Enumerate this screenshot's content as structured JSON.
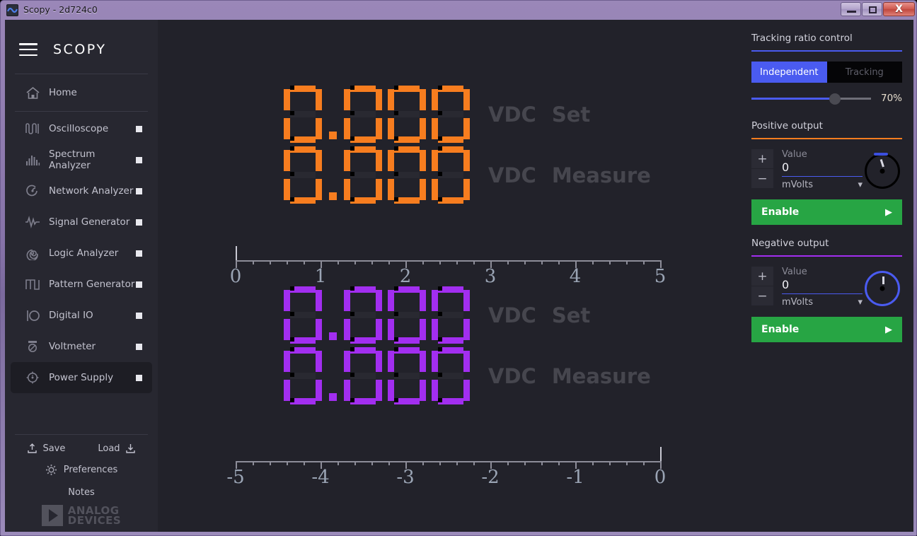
{
  "window": {
    "title": "Scopy - 2d724c0",
    "minimize_label": "Minimize",
    "maximize_label": "Maximize",
    "close_label": "X"
  },
  "sidebar": {
    "logo": "SCOPY",
    "home": {
      "label": "Home",
      "icon": "home-icon"
    },
    "items": [
      {
        "label": "Oscilloscope",
        "icon": "oscilloscope-icon"
      },
      {
        "label": "Spectrum Analyzer",
        "icon": "spectrum-analyzer-icon"
      },
      {
        "label": "Network Analyzer",
        "icon": "network-analyzer-icon"
      },
      {
        "label": "Signal Generator",
        "icon": "signal-generator-icon"
      },
      {
        "label": "Logic Analyzer",
        "icon": "logic-analyzer-icon"
      },
      {
        "label": "Pattern Generator",
        "icon": "pattern-generator-icon"
      },
      {
        "label": "Digital IO",
        "icon": "digital-io-icon"
      },
      {
        "label": "Voltmeter",
        "icon": "voltmeter-icon"
      },
      {
        "label": "Power Supply",
        "icon": "power-supply-icon"
      }
    ],
    "active_item": "Power Supply",
    "footer": {
      "save": "Save",
      "load": "Load",
      "preferences": "Preferences",
      "notes": "Notes",
      "brand_line1": "ANALOG",
      "brand_line2": "DEVICES"
    }
  },
  "main": {
    "positive": {
      "color": "#f77d1f",
      "set": {
        "value": "0.000",
        "unit": "VDC",
        "label": "Set"
      },
      "measure": {
        "value": "0.000",
        "unit": "VDC",
        "label": "Measure"
      },
      "ruler": {
        "ticks": [
          "0",
          "1",
          "2",
          "3",
          "4",
          "5"
        ],
        "min": 0,
        "max": 5,
        "cursor": 0
      }
    },
    "negative": {
      "color": "#a22ef0",
      "set": {
        "value": "0.000",
        "unit": "VDC",
        "label": "Set"
      },
      "measure": {
        "value": "0.000",
        "unit": "VDC",
        "label": "Measure"
      },
      "ruler": {
        "ticks": [
          "-5",
          "-4",
          "-3",
          "-2",
          "-1",
          "0"
        ],
        "min": -5,
        "max": 0,
        "cursor": 0
      }
    }
  },
  "right": {
    "tracking": {
      "title": "Tracking ratio control",
      "rule_color": "#4a5bf0",
      "mode_independent": "Independent",
      "mode_tracking": "Tracking",
      "selected_mode": "Independent",
      "ratio_percent": "70%",
      "ratio_value": 70
    },
    "positive_output": {
      "title": "Positive output",
      "rule_color": "#f77d1f",
      "plus": "+",
      "minus": "−",
      "value_caption": "Value",
      "value": "0",
      "unit": "mVolts",
      "enable_label": "Enable",
      "enable_arrow": "▶"
    },
    "negative_output": {
      "title": "Negative output",
      "rule_color": "#a22ef0",
      "plus": "+",
      "minus": "−",
      "value_caption": "Value",
      "value": "0",
      "unit": "mVolts",
      "enable_label": "Enable",
      "enable_arrow": "▶"
    }
  }
}
